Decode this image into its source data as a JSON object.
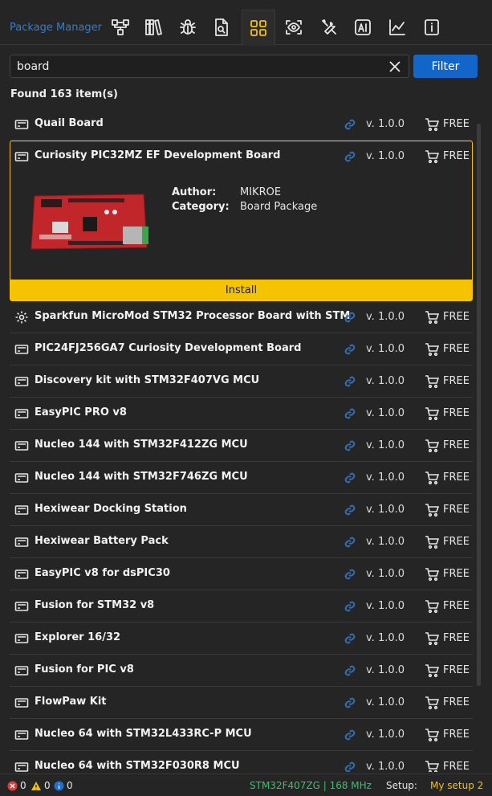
{
  "header": {
    "title": "Package Manager",
    "tabs": [
      {
        "icon": "network-icon"
      },
      {
        "icon": "library-icon"
      },
      {
        "icon": "bug-icon"
      },
      {
        "icon": "file-search-icon"
      },
      {
        "icon": "packages-icon",
        "active": true
      },
      {
        "icon": "eye-icon"
      },
      {
        "icon": "tools-icon"
      },
      {
        "icon": "ai-icon"
      },
      {
        "icon": "chart-line-icon"
      },
      {
        "icon": "info-icon"
      }
    ]
  },
  "search": {
    "value": "board",
    "placeholder": ""
  },
  "filter_label": "Filter",
  "found_text": "Found 163 item(s)",
  "expanded": {
    "name": "Curiosity PIC32MZ EF Development Board",
    "version": "v. 1.0.0",
    "price": "FREE",
    "author_label": "Author:",
    "author": "MIKROE",
    "category_label": "Category:",
    "category": "Board Package",
    "install_label": "Install"
  },
  "items": [
    {
      "name": "Quail Board",
      "version": "v. 1.0.0",
      "price": "FREE",
      "icon": "board-icon"
    },
    {
      "name": "Sparkfun MicroMod STM32 Processor Board with STM",
      "version": "v. 1.0.0",
      "price": "FREE",
      "icon": "gear-icon"
    },
    {
      "name": "PIC24FJ256GA7 Curiosity Development Board",
      "version": "v. 1.0.0",
      "price": "FREE",
      "icon": "board-icon"
    },
    {
      "name": "Discovery kit with STM32F407VG MCU",
      "version": "v. 1.0.0",
      "price": "FREE",
      "icon": "board-icon"
    },
    {
      "name": "EasyPIC PRO v8",
      "version": "v. 1.0.0",
      "price": "FREE",
      "icon": "board-icon"
    },
    {
      "name": "Nucleo 144 with STM32F412ZG MCU",
      "version": "v. 1.0.0",
      "price": "FREE",
      "icon": "board-icon"
    },
    {
      "name": "Nucleo 144 with STM32F746ZG MCU",
      "version": "v. 1.0.0",
      "price": "FREE",
      "icon": "board-icon"
    },
    {
      "name": "Hexiwear Docking Station",
      "version": "v. 1.0.0",
      "price": "FREE",
      "icon": "board-icon"
    },
    {
      "name": "Hexiwear Battery Pack",
      "version": "v. 1.0.0",
      "price": "FREE",
      "icon": "board-icon"
    },
    {
      "name": "EasyPIC v8 for dsPIC30",
      "version": "v. 1.0.0",
      "price": "FREE",
      "icon": "board-icon"
    },
    {
      "name": "Fusion for STM32 v8",
      "version": "v. 1.0.0",
      "price": "FREE",
      "icon": "board-icon"
    },
    {
      "name": "Explorer 16/32",
      "version": "v. 1.0.0",
      "price": "FREE",
      "icon": "board-icon"
    },
    {
      "name": "Fusion for PIC v8",
      "version": "v. 1.0.0",
      "price": "FREE",
      "icon": "board-icon"
    },
    {
      "name": "FlowPaw Kit",
      "version": "v. 1.0.0",
      "price": "FREE",
      "icon": "board-icon"
    },
    {
      "name": "Nucleo 64 with STM32L433RC-P MCU",
      "version": "v. 1.0.0",
      "price": "FREE",
      "icon": "board-icon"
    },
    {
      "name": "Nucleo 64 with STM32F030R8 MCU",
      "version": "v. 1.0.0",
      "price": "FREE",
      "icon": "board-icon"
    }
  ],
  "status": {
    "errors": "0",
    "warnings": "0",
    "infos": "0",
    "mcu": "STM32F407ZG | 168 MHz",
    "setup_label": "Setup:",
    "setup_value": "My setup 2"
  },
  "colors": {
    "accent": "#f6c300",
    "link": "#2f7dd8",
    "button": "#1366c9",
    "mcu": "#36c46b",
    "background": "#252525"
  }
}
